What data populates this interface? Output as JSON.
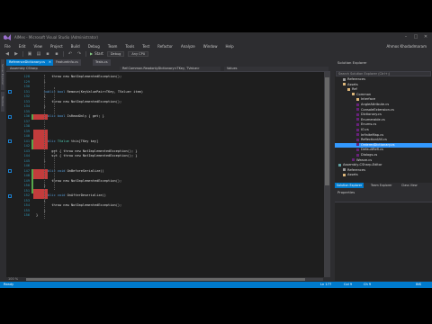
{
  "window": {
    "title": "AIMes - Microsoft Visual Studio (Administrator)",
    "user": "Ahmos Khodadmaram"
  },
  "menu": [
    "File",
    "Edit",
    "View",
    "Project",
    "Build",
    "Debug",
    "Team",
    "Tools",
    "Test",
    "Refactor",
    "Analyze",
    "Window",
    "Help"
  ],
  "toolbar": {
    "config": "Debug",
    "platform": "Any CPU",
    "start_label": "Start"
  },
  "left_rail": [
    "Server Explorer",
    "Toolbox"
  ],
  "doc_tabs": [
    "ReferenceDictionary.cs",
    "FeatureInfo.cs",
    "Tests.cs"
  ],
  "navbar": {
    "project": "Assembly CSharp",
    "type": "Ref.Common.ReadonlyDictionary<TKey, TValue>",
    "member": "Values"
  },
  "code_lines": [
    {
      "n": "128",
      "parts": [
        [
          "tx",
          "        throw new NotImplementedException();"
        ]
      ]
    },
    {
      "n": "129",
      "parts": [
        [
          "tx",
          "    }"
        ]
      ]
    },
    {
      "n": "130",
      "parts": [
        [
          "tx",
          ""
        ]
      ]
    },
    {
      "n": "131",
      "parts": [
        [
          "kw",
          "    public bool "
        ],
        [
          "tx",
          "Remove(KeyValuePair<TKey, TValue> item)"
        ]
      ]
    },
    {
      "n": "132",
      "parts": [
        [
          "tx",
          "    {"
        ]
      ]
    },
    {
      "n": "133",
      "parts": [
        [
          "tx",
          "        throw new NotImplementedException();"
        ]
      ]
    },
    {
      "n": "134",
      "parts": [
        [
          "tx",
          "    }"
        ]
      ]
    },
    {
      "n": "135",
      "parts": [
        [
          "tx",
          ""
        ]
      ]
    },
    {
      "n": "136",
      "parts": [
        [
          "kw",
          "    public bool "
        ],
        [
          "tx",
          "IsReadOnly { get; }"
        ]
      ]
    },
    {
      "n": "137",
      "parts": [
        [
          "tx",
          ""
        ]
      ]
    },
    {
      "n": "138",
      "parts": [
        [
          "tx",
          ""
        ]
      ]
    },
    {
      "n": "139",
      "parts": [
        [
          "tx",
          ""
        ]
      ]
    },
    {
      "n": "140",
      "parts": [
        [
          "tx",
          ""
        ]
      ]
    },
    {
      "n": "141",
      "parts": [
        [
          "kw",
          "    public "
        ],
        [
          "ty",
          "TValue "
        ],
        [
          "tx",
          "this[TKey key]"
        ]
      ]
    },
    {
      "n": "142",
      "parts": [
        [
          "tx",
          "    {"
        ]
      ]
    },
    {
      "n": "143",
      "parts": [
        [
          "tx",
          "        get { throw new NotImplementedException(); }"
        ]
      ]
    },
    {
      "n": "144",
      "parts": [
        [
          "tx",
          "        set { throw new NotImplementedException(); }"
        ]
      ]
    },
    {
      "n": "145",
      "parts": [
        [
          "tx",
          "    }"
        ]
      ]
    },
    {
      "n": "146",
      "parts": [
        [
          "tx",
          ""
        ]
      ]
    },
    {
      "n": "147",
      "parts": [
        [
          "kw",
          "    public void "
        ],
        [
          "tx",
          "OnBeforeSerialize()"
        ]
      ]
    },
    {
      "n": "148",
      "parts": [
        [
          "tx",
          "    {"
        ]
      ]
    },
    {
      "n": "149",
      "parts": [
        [
          "tx",
          "        throw new NotImplementedException();"
        ]
      ]
    },
    {
      "n": "150",
      "parts": [
        [
          "tx",
          "    }"
        ]
      ]
    },
    {
      "n": "151",
      "parts": [
        [
          "tx",
          ""
        ]
      ]
    },
    {
      "n": "152",
      "parts": [
        [
          "kw",
          "    public void "
        ],
        [
          "tx",
          "OnAfterDeserialize()"
        ]
      ]
    },
    {
      "n": "153",
      "parts": [
        [
          "tx",
          "    {"
        ]
      ]
    },
    {
      "n": "154",
      "parts": [
        [
          "tx",
          "        throw new NotImplementedException();"
        ]
      ]
    },
    {
      "n": "155",
      "parts": [
        [
          "tx",
          "    }"
        ]
      ]
    },
    {
      "n": "156",
      "parts": [
        [
          "tx",
          "}"
        ]
      ]
    }
  ],
  "zoom": "100 %",
  "solution_explorer": {
    "title": "Solution Explorer",
    "search_placeholder": "Search Solution Explorer (Ctrl+;)",
    "items": [
      {
        "label": "References",
        "icon": "ref",
        "depth": 1
      },
      {
        "label": "Assets",
        "icon": "folder",
        "depth": 1
      },
      {
        "label": "Ref",
        "icon": "folder",
        "depth": 2
      },
      {
        "label": "Common",
        "icon": "folder",
        "depth": 3
      },
      {
        "label": "Interface",
        "icon": "folder",
        "depth": 4
      },
      {
        "label": "AngleAttribute.cs",
        "icon": "cs",
        "depth": 4
      },
      {
        "label": "ConsoleExtension.cs",
        "icon": "cs",
        "depth": 4
      },
      {
        "label": "Dictionary.cs",
        "icon": "cs",
        "depth": 4
      },
      {
        "label": "Enumerable.cs",
        "icon": "cs",
        "depth": 4
      },
      {
        "label": "Enums.cs",
        "icon": "cs",
        "depth": 4
      },
      {
        "label": "IO.cs",
        "icon": "cs",
        "depth": 4
      },
      {
        "label": "InfiniteMap.cs",
        "icon": "cs",
        "depth": 4
      },
      {
        "label": "ReflectionUtil.cs",
        "icon": "cs",
        "depth": 4
      },
      {
        "label": "OrderedDictionary.cs",
        "icon": "cs",
        "depth": 4,
        "selected": true
      },
      {
        "label": "DefaultRefl.cs",
        "icon": "cs",
        "depth": 4
      },
      {
        "label": "Dialogs.cs",
        "icon": "cs",
        "depth": 4
      },
      {
        "label": "Weave.cs",
        "icon": "cs",
        "depth": 3
      },
      {
        "label": "Assembly-CSharp-Editor",
        "icon": "proj",
        "depth": 0
      },
      {
        "label": "References",
        "icon": "ref",
        "depth": 1
      },
      {
        "label": "Assets",
        "icon": "folder",
        "depth": 1
      }
    ],
    "tabs": [
      "Solution Explorer",
      "Team Explorer",
      "Class View"
    ]
  },
  "properties": {
    "title": "Properties"
  },
  "status": {
    "left": "Ready",
    "ln": "Ln 177",
    "col": "Col 9",
    "ch": "Ch 9",
    "ins": "INS"
  },
  "colors": {
    "accent": "#007acc",
    "coverage_red": "#c33c3c",
    "selection": "#3399ff"
  }
}
